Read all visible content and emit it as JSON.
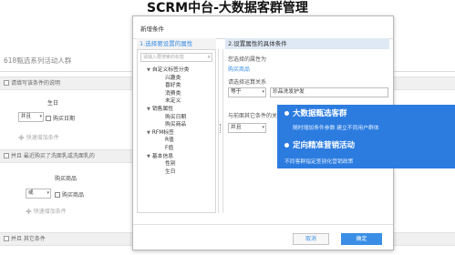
{
  "headline": "SCRM中台-大数据客群管理",
  "background": {
    "page_title": "618甄选系列活动人群",
    "section1_label": "请填写该条件的说明",
    "birthday_label": "生日",
    "birthday_op": "并且",
    "buy_date_label": "购买日期",
    "add_condition": "快速增加条件",
    "section2_label": "并且 最近购买了洗面乳或洗面乳的",
    "buy_product_label": "购买商品",
    "buy_product_op": "或",
    "buy_product_value": "购买商品",
    "section3_label": "并且 其它条件"
  },
  "modal": {
    "title": "新增条件",
    "step1": "1.选择要设置的属性",
    "step2": "2.设置属性的具体条件",
    "search_placeholder": "请输入要搜索的标签",
    "search_icon": "search-icon",
    "tree": [
      {
        "label": "自定义标签分类",
        "level": 0,
        "expanded": true
      },
      {
        "label": "兴趣类",
        "level": 1
      },
      {
        "label": "喜好类",
        "level": 1
      },
      {
        "label": "消费类",
        "level": 1
      },
      {
        "label": "未定义",
        "level": 1
      },
      {
        "label": "销售属性",
        "level": 0,
        "expanded": true
      },
      {
        "label": "购买日期",
        "level": 1
      },
      {
        "label": "购买商品",
        "level": 1
      },
      {
        "label": "RFM标签",
        "level": 0,
        "expanded": true
      },
      {
        "label": "R值",
        "level": 1
      },
      {
        "label": "F值",
        "level": 1
      },
      {
        "label": "基本信息",
        "level": 0,
        "expanded": true
      },
      {
        "label": "性别",
        "level": 1
      },
      {
        "label": "生日",
        "level": 1
      }
    ],
    "selected_attr_label": "您选择的属性为",
    "selected_attr_value": "购买商品",
    "operator_label": "请选择运算关系",
    "operator_value": "等于",
    "operator_input": "珍品洗发护发",
    "relation_label": "与前面其它条件的关系",
    "relation_value": "并且",
    "cancel": "取消",
    "confirm": "确定"
  },
  "callout": {
    "title1": "大数据甄选客群",
    "desc1": "随时增加条件参数 建立不同用户群体",
    "title2": "定向精准营销活动",
    "desc2": "不同客群指定差别化营销政策"
  },
  "colors": {
    "accent": "#3a8ee6",
    "callout_bg": "#2c7ce0"
  }
}
